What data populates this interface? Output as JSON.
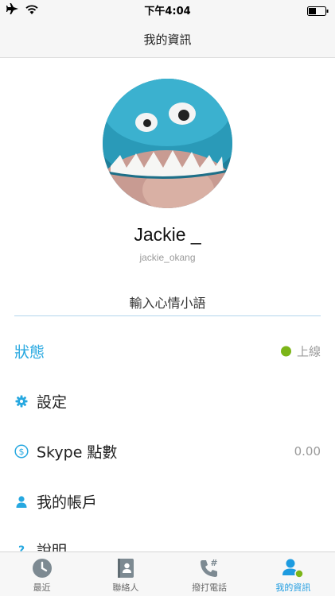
{
  "status_bar": {
    "time": "下午4:04"
  },
  "nav": {
    "title": "我的資訊"
  },
  "profile": {
    "display_name": "Jackie _",
    "username": "jackie_okang",
    "mood_placeholder": "輸入心情小語"
  },
  "menu": {
    "status": {
      "label": "狀態",
      "value": "上線",
      "indicator_color": "#7cb518"
    },
    "settings": {
      "label": "設定",
      "icon": "gear-icon"
    },
    "credit": {
      "label": "Skype 點數",
      "value": "0.00",
      "icon": "dollar-icon"
    },
    "account": {
      "label": "我的帳戶",
      "icon": "person-icon"
    },
    "help": {
      "label": "說明",
      "icon": "question-icon"
    }
  },
  "tabs": [
    {
      "label": "最近",
      "icon": "clock-icon",
      "active": false
    },
    {
      "label": "聯絡人",
      "icon": "contacts-book-icon",
      "active": false
    },
    {
      "label": "撥打電話",
      "icon": "dialpad-phone-icon",
      "active": false
    },
    {
      "label": "我的資訊",
      "icon": "my-info-icon",
      "active": true
    }
  ],
  "colors": {
    "accent": "#27a8e0",
    "online": "#7cb518",
    "muted": "#9b9b9b"
  }
}
